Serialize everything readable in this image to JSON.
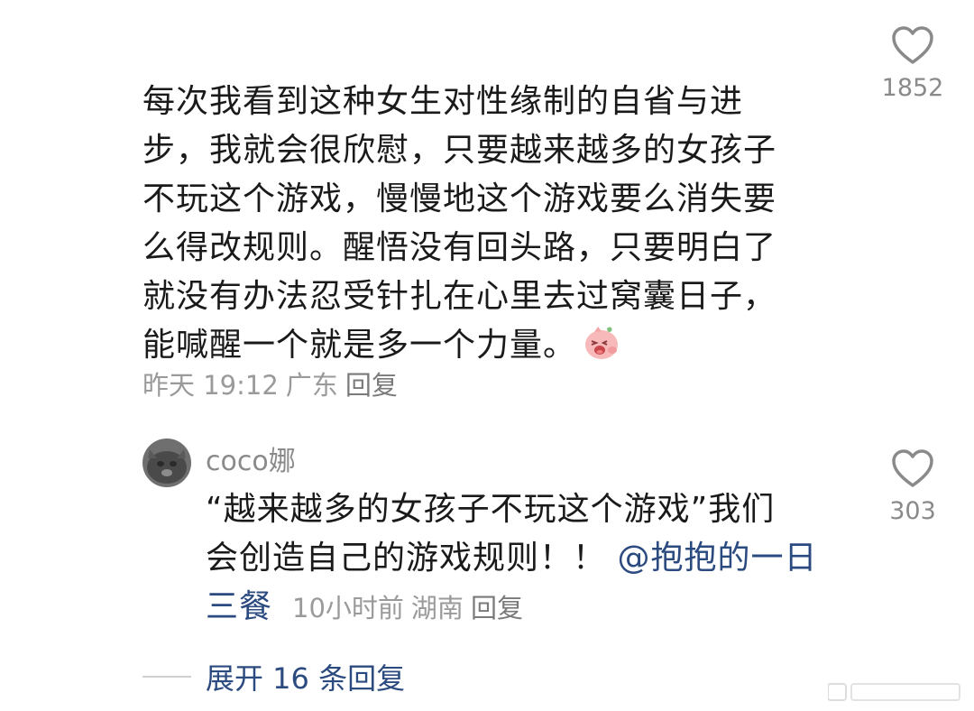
{
  "main_comment": {
    "text_lines": [
      "每次我看到这种女生对性缘制的自省与进",
      "步，我就会很欣慰，只要越来越多的女孩子",
      "不玩这个游戏，慢慢地这个游戏要么消失要",
      "么得改规则。醒悟没有回头路，只要明白了",
      "就没有办法忍受针扎在心里去过窝囊日子，",
      "能喊醒一个就是多一个力量。"
    ],
    "emoji_icon": "laughing-pig-emoji",
    "time": "昨天 19:12",
    "location": "广东",
    "reply_label": "回复",
    "like_icon": "heart-outline-icon",
    "like_count": "1852"
  },
  "reply": {
    "username": "coco娜",
    "text_line1": "“越来越多的女孩子不玩这个游戏”我们",
    "text_line2_prefix": "会创造自己的游戏规则！！",
    "mention_part1": "@抱抱的一日",
    "mention_part2": "三餐",
    "time": "10小时前",
    "location": "湖南",
    "reply_label": "回复",
    "like_icon": "heart-outline-icon",
    "like_count": "303"
  },
  "expand": {
    "label": "展开 16 条回复"
  },
  "colors": {
    "text": "#1a1a1a",
    "meta": "#9a9a9a",
    "link": "#2b4a7f"
  }
}
